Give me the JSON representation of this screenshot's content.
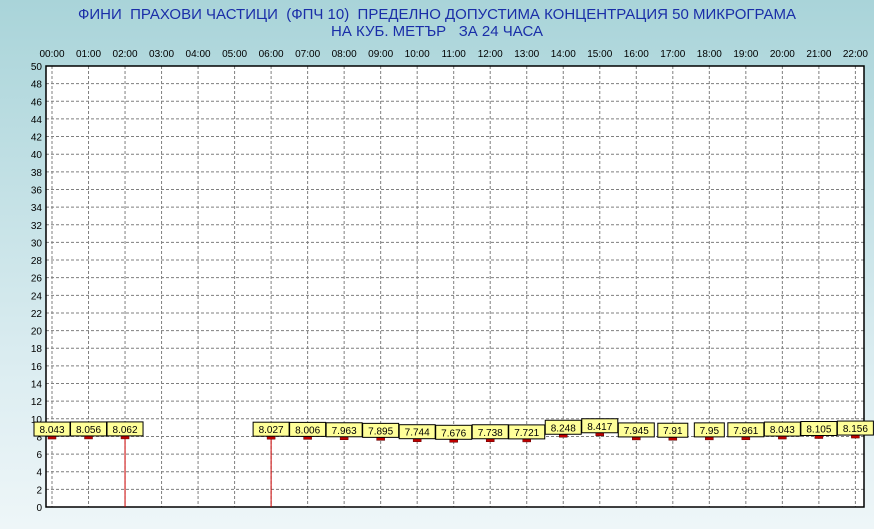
{
  "chart_data": {
    "type": "bar",
    "title_line1": "ФИНИ  ПРАХОВИ ЧАСТИЦИ  (ФПЧ 10)  ПРЕДЕЛНО ДОПУСТИМА КОНЦЕНТРАЦИЯ 50 МИКРОГРАМА",
    "title_line2": "НА КУБ. МЕТЪР   ЗА 24 ЧАСА",
    "categories": [
      "00:00",
      "01:00",
      "02:00",
      "03:00",
      "04:00",
      "05:00",
      "06:00",
      "07:00",
      "08:00",
      "09:00",
      "10:00",
      "11:00",
      "12:00",
      "13:00",
      "14:00",
      "15:00",
      "16:00",
      "17:00",
      "18:00",
      "19:00",
      "20:00",
      "21:00",
      "22:00"
    ],
    "values": [
      8.043,
      8.056,
      8.062,
      null,
      null,
      null,
      8.027,
      8.006,
      7.963,
      7.895,
      7.744,
      7.676,
      7.738,
      7.721,
      8.248,
      8.417,
      7.945,
      7.91,
      7.95,
      7.961,
      8.043,
      8.105,
      8.156
    ],
    "value_labels": [
      "8.043",
      "8.056",
      "8.062",
      "",
      "",
      "",
      "8.027",
      "8.006",
      "7.963",
      "7.895",
      "7.744",
      "7.676",
      "7.738",
      "7.721",
      "8.248",
      "8.417",
      "7.945",
      "7.91",
      "7.95",
      "7.961",
      "8.043",
      "8.105",
      "8.156"
    ],
    "ylim": [
      0,
      50
    ],
    "yticks": [
      0,
      2,
      4,
      6,
      8,
      10,
      12,
      14,
      16,
      18,
      20,
      22,
      24,
      26,
      28,
      30,
      32,
      34,
      36,
      38,
      40,
      42,
      44,
      46,
      48,
      50
    ],
    "xlabel": "",
    "ylabel": "",
    "grid": true,
    "reference_hours": [
      "02:00",
      "06:00"
    ],
    "colors": {
      "title": "#1a2ea8",
      "marker": "#c00000",
      "label_bg": "#ffff99",
      "reference_line": "#cc0000",
      "grid": "#7f7f7f"
    }
  }
}
